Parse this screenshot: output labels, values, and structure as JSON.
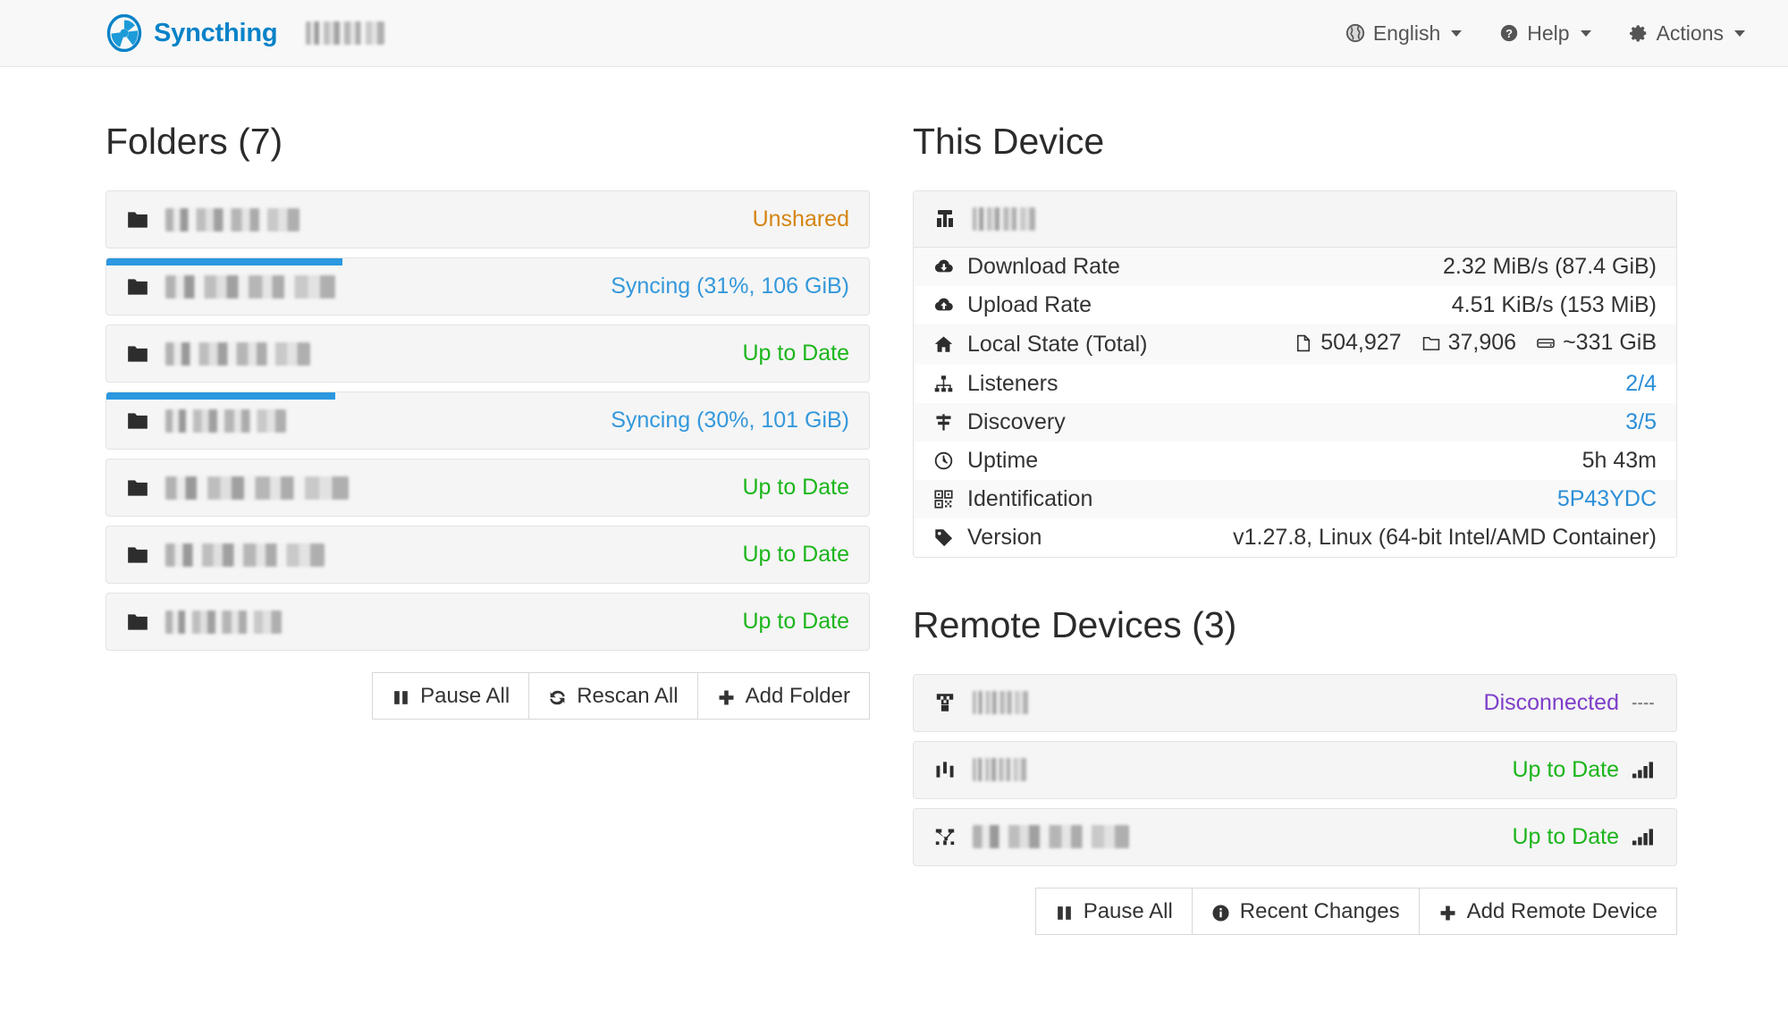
{
  "navbar": {
    "brand": "Syncthing",
    "brand_icon": "syncthing-logo-icon",
    "device_name_redacted": true,
    "items": [
      {
        "label": "English",
        "icon": "globe-icon"
      },
      {
        "label": "Help",
        "icon": "question-circle-icon"
      },
      {
        "label": "Actions",
        "icon": "gear-icon"
      }
    ]
  },
  "folders": {
    "title": "Folders (7)",
    "count": 7,
    "rows": [
      {
        "icon": "folder-icon",
        "name_redacted": true,
        "redact_width": 150,
        "status": "Unshared",
        "status_color": "orange",
        "progress": null
      },
      {
        "icon": "folder-icon",
        "name_redacted": true,
        "redact_width": 190,
        "status": "Syncing (31%, 106 GiB)",
        "status_color": "blue",
        "progress": 31
      },
      {
        "icon": "folder-icon",
        "name_redacted": true,
        "redact_width": 162,
        "status": "Up to Date",
        "status_color": "green",
        "progress": null
      },
      {
        "icon": "folder-icon",
        "name_redacted": true,
        "redact_width": 135,
        "status": "Syncing (30%, 101 GiB)",
        "status_color": "blue",
        "progress": 30
      },
      {
        "icon": "folder-icon",
        "name_redacted": true,
        "redact_width": 205,
        "status": "Up to Date",
        "status_color": "green",
        "progress": null
      },
      {
        "icon": "folder-icon",
        "name_redacted": true,
        "redact_width": 178,
        "status": "Up to Date",
        "status_color": "green",
        "progress": null
      },
      {
        "icon": "folder-icon",
        "name_redacted": true,
        "redact_width": 130,
        "status": "Up to Date",
        "status_color": "green",
        "progress": null
      }
    ],
    "buttons": [
      {
        "label": "Pause All",
        "icon": "pause-icon"
      },
      {
        "label": "Rescan All",
        "icon": "refresh-icon"
      },
      {
        "label": "Add Folder",
        "icon": "plus-icon"
      }
    ]
  },
  "this_device": {
    "title": "This Device",
    "header_icon": "server-icon",
    "name_redacted": true,
    "stats": [
      {
        "label": "Download Rate",
        "icon": "cloud-download-icon",
        "value": "2.32 MiB/s (87.4 GiB)",
        "link": false
      },
      {
        "label": "Upload Rate",
        "icon": "cloud-upload-icon",
        "value": "4.51 KiB/s (153 MiB)",
        "link": false
      },
      {
        "label": "Local State (Total)",
        "icon": "home-icon",
        "value": null,
        "link": false,
        "local_state": [
          {
            "icon": "file-icon",
            "value": "504,927"
          },
          {
            "icon": "folder-outline-icon",
            "value": "37,906"
          },
          {
            "icon": "hdd-icon",
            "value": "~331 GiB"
          }
        ]
      },
      {
        "label": "Listeners",
        "icon": "sitemap-icon",
        "value": "2/4",
        "link": true
      },
      {
        "label": "Discovery",
        "icon": "signpost-icon",
        "value": "3/5",
        "link": true
      },
      {
        "label": "Uptime",
        "icon": "clock-icon",
        "value": "5h 43m",
        "link": false
      },
      {
        "label": "Identification",
        "icon": "qrcode-icon",
        "value": "5P43YDC",
        "link": true
      },
      {
        "label": "Version",
        "icon": "tag-icon",
        "value": "v1.27.8, Linux (64-bit Intel/AMD Container)",
        "link": false
      }
    ]
  },
  "remote_devices": {
    "title": "Remote Devices (3)",
    "count": 3,
    "rows": [
      {
        "icon": "device-rack-icon",
        "name_redacted": true,
        "redact_width": 62,
        "status": "Disconnected",
        "status_color": "purple",
        "signal": "none"
      },
      {
        "icon": "device-bars-icon",
        "name_redacted": true,
        "redact_width": 60,
        "status": "Up to Date",
        "status_color": "green",
        "signal": "strong"
      },
      {
        "icon": "device-network-icon",
        "name_redacted": true,
        "redact_width": 175,
        "status": "Up to Date",
        "status_color": "green",
        "signal": "strong"
      }
    ],
    "buttons": [
      {
        "label": "Pause All",
        "icon": "pause-icon"
      },
      {
        "label": "Recent Changes",
        "icon": "info-circle-icon"
      },
      {
        "label": "Add Remote Device",
        "icon": "plus-icon"
      }
    ]
  },
  "colors": {
    "brand": "#0882C8",
    "up_to_date": "#1bb51b",
    "syncing": "#3498db",
    "unshared": "#d58512",
    "disconnected": "#7d3ec9",
    "progress_bar": "#2b98e0",
    "link": "#2b8fd8"
  }
}
